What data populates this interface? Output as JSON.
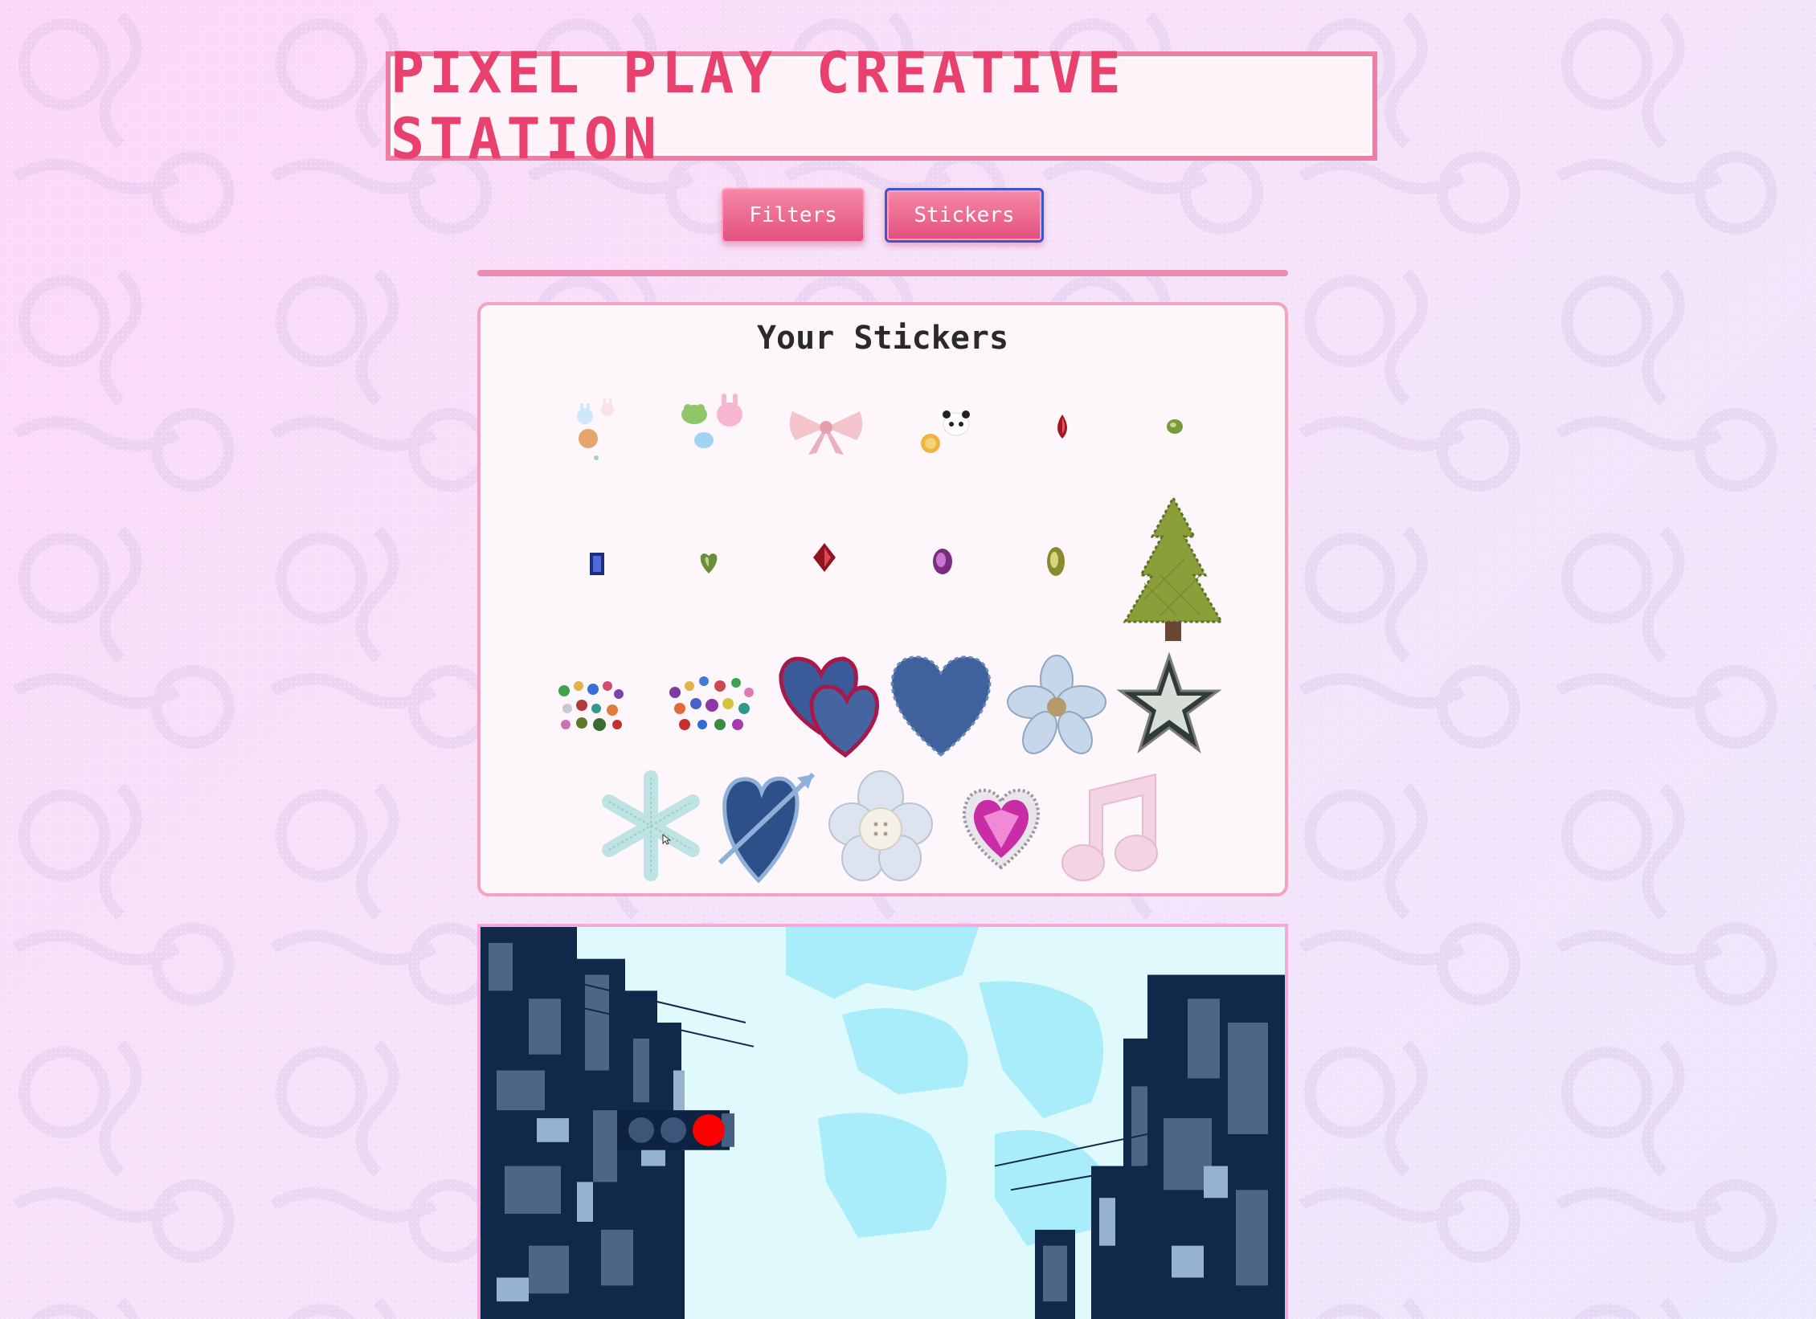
{
  "header": {
    "title": "PIXEL PLAY CREATIVE STATION"
  },
  "tabs": [
    {
      "label": "Filters"
    },
    {
      "label": "Stickers"
    }
  ],
  "stickers_panel": {
    "title": "Your Stickers",
    "stickers": [
      "bunny-friends-sticker",
      "animal-faces-sticker",
      "pink-bow-sticker",
      "panda-lion-sticker",
      "red-gem-sticker",
      "green-gem-sticker",
      "blue-gem-sticker",
      "green-heart-gem-sticker",
      "red-diamond-gem-sticker",
      "purple-gem-sticker",
      "yellow-gem-sticker",
      "christmas-tree-sticker",
      "gem-cluster-sticker",
      "gem-pile-sticker",
      "double-heart-sticker",
      "denim-heart-sticker",
      "flower-button-sticker",
      "silver-star-sticker",
      "snowflake-sticker",
      "heart-arrow-sticker",
      "plaid-flower-button-sticker",
      "pink-heart-jewel-sticker",
      "music-note-sticker"
    ]
  },
  "colors": {
    "accent": "#e8416e",
    "tab_active_border": "#3d56c9",
    "panel_border": "#f3a2c2",
    "photo_border": "#f9a6dc"
  },
  "canvas_photo": {
    "description_label": ""
  }
}
